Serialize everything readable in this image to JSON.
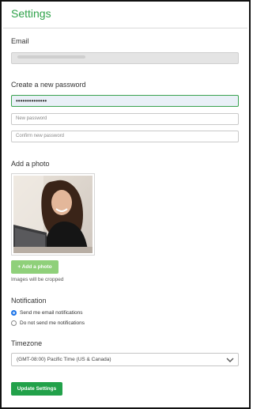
{
  "page": {
    "title": "Settings"
  },
  "email": {
    "label": "Email",
    "value": ""
  },
  "password": {
    "section_label": "Create a new password",
    "current_value": "••••••••••••••",
    "new_placeholder": "New password",
    "confirm_placeholder": "Confirm new password"
  },
  "photo": {
    "section_label": "Add a photo",
    "add_button_label": "+ Add a photo",
    "note": "Images will be cropped"
  },
  "notification": {
    "section_label": "Notification",
    "options": [
      {
        "label": "Send me email notifications",
        "selected": true
      },
      {
        "label": "Do not send me notifications",
        "selected": false
      }
    ]
  },
  "timezone": {
    "section_label": "Timezone",
    "selected": "(GMT-08:00) Pacific Time (US & Canada)"
  },
  "actions": {
    "update_label": "Update Settings"
  },
  "colors": {
    "accent_green": "#2fa24a",
    "button_light_green": "#8fd07a",
    "button_dark_green": "#22a14a",
    "radio_blue": "#1a73e8"
  }
}
